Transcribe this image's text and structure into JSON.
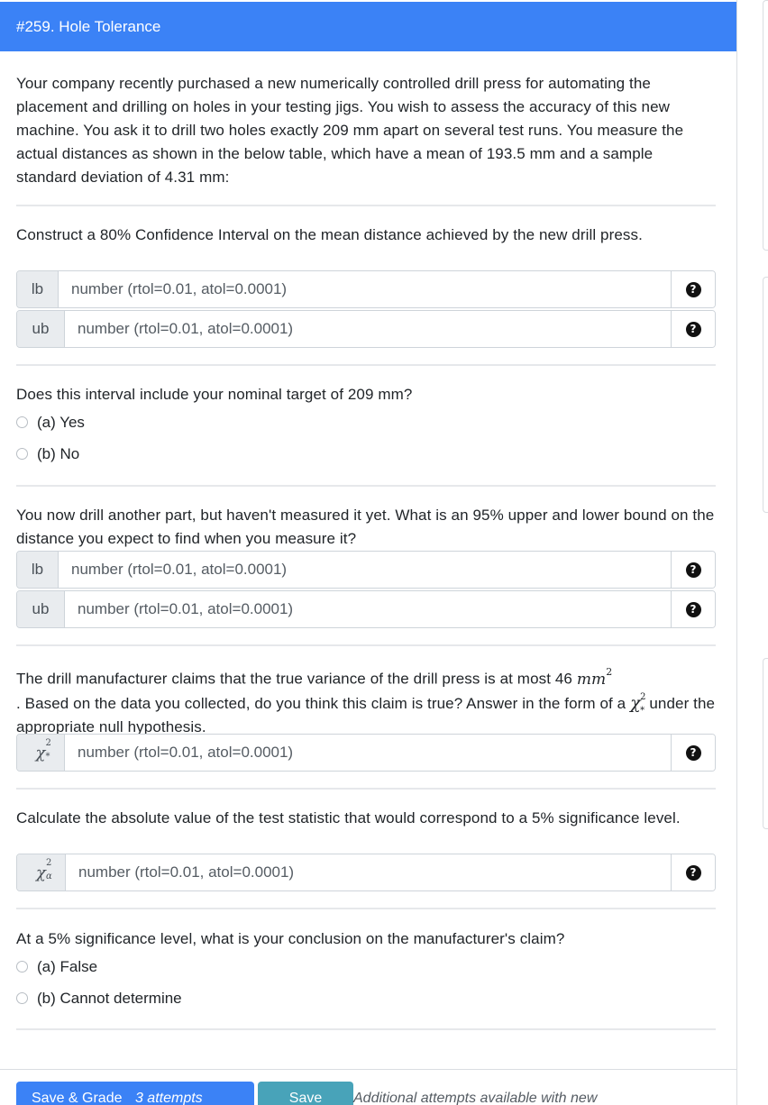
{
  "header": {
    "title": "#259. Hole Tolerance"
  },
  "intro": "Your company recently purchased a new numerically controlled drill press for automating the placement and drilling on holes in your testing jigs. You wish to assess the accuracy of this new machine. You ask it to drill two holes exactly 209 mm apart on several test runs. You measure the actual distances as shown in the below table, which have a mean of 193.5 mm and a sample standard deviation of 4.31 mm:",
  "q1": {
    "prompt": "Construct a 80% Confidence Interval on the mean distance achieved by the new drill press.",
    "inputs": [
      {
        "label": "lb",
        "placeholder": "number (rtol=0.01, atol=0.0001)"
      },
      {
        "label": "ub",
        "placeholder": "number (rtol=0.01, atol=0.0001)"
      }
    ]
  },
  "q2": {
    "prompt": "Does this interval include your nominal target of 209 mm?",
    "options": [
      "(a) Yes",
      "(b) No"
    ]
  },
  "q3": {
    "prompt": "You now drill another part, but haven't measured it yet. What is an 95% upper and lower bound on the distance you expect to find when you measure it?",
    "inputs": [
      {
        "label": "lb",
        "placeholder": "number (rtol=0.01, atol=0.0001)"
      },
      {
        "label": "ub",
        "placeholder": "number (rtol=0.01, atol=0.0001)"
      }
    ]
  },
  "q4": {
    "prompt_a": "The drill manufacturer claims that the true variance of the drill press is at most 46",
    "unit": "mm",
    "unit_exp": "2",
    "prompt_b": ". Based on the data you collected, do you think this claim is true? Answer in the form of a",
    "prompt_c": "under the appropriate null hypothesis.",
    "chi_symbol": "χ",
    "chi_sup": "2",
    "chi_sub": "*",
    "input": {
      "placeholder": "number (rtol=0.01, atol=0.0001)"
    }
  },
  "q5": {
    "prompt": "Calculate the absolute value of the test statistic that would correspond to a 5% significance level.",
    "chi_symbol": "χ",
    "chi_sup": "2",
    "chi_sub": "α",
    "input": {
      "placeholder": "number (rtol=0.01, atol=0.0001)"
    }
  },
  "q6": {
    "prompt": "At a 5% significance level, what is your conclusion on the manufacturer's claim?",
    "options": [
      "(a) False",
      "(b) Cannot determine"
    ]
  },
  "footer": {
    "save_grade_label": "Save & Grade",
    "attempts_label": "3 attempts",
    "save_label": "Save",
    "note": "Additional attempts available with new"
  },
  "help_glyph": "?",
  "colors": {
    "header_bg": "#3b82f6",
    "primary": "#3b82f6",
    "info": "#48a3b9"
  }
}
